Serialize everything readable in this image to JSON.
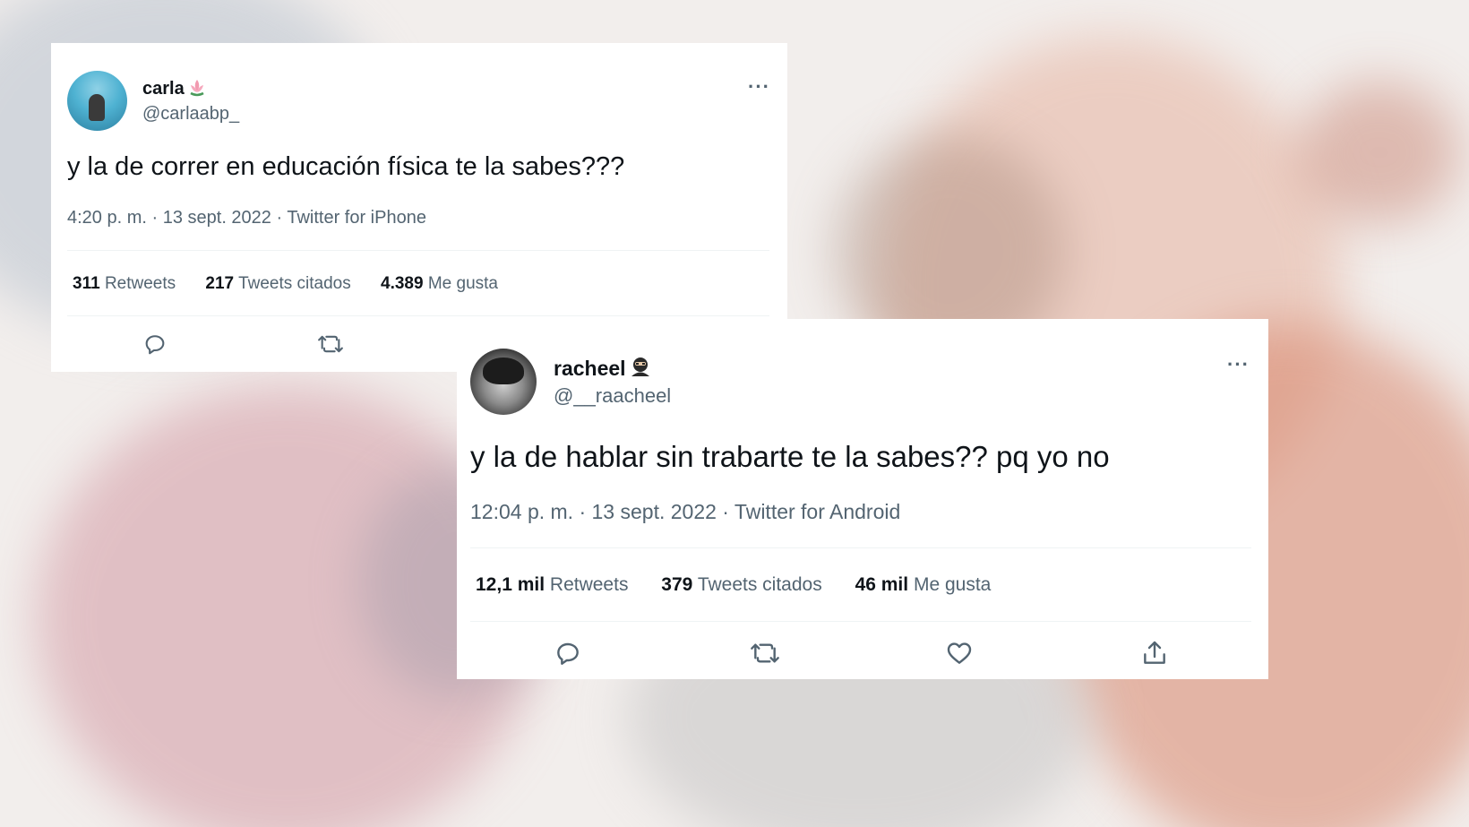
{
  "tweets": [
    {
      "display_name": "carla",
      "name_emoji": "lotus-emoji",
      "handle": "@carlaabp_",
      "more": "···",
      "text": "y la de correr en educación física te la sabes???",
      "meta": "4:20 p. m. · 13 sept. 2022 · Twitter for iPhone",
      "stats": {
        "retweets_count": "311",
        "retweets_label": "Retweets",
        "quotes_count": "217",
        "quotes_label": "Tweets citados",
        "likes_count": "4.389",
        "likes_label": "Me gusta"
      },
      "actions": [
        "reply-icon",
        "retweet-icon"
      ]
    },
    {
      "display_name": "racheel",
      "name_emoji": "ninja-emoji",
      "handle": "@__raacheel",
      "more": "···",
      "text": "y la de hablar sin trabarte te la sabes?? pq yo no",
      "meta": "12:04 p. m. · 13 sept. 2022 · Twitter for Android",
      "stats": {
        "retweets_count": "12,1 mil",
        "retweets_label": "Retweets",
        "quotes_count": "379",
        "quotes_label": "Tweets citados",
        "likes_count": "46 mil",
        "likes_label": "Me gusta"
      },
      "actions": [
        "reply-icon",
        "retweet-icon",
        "like-icon",
        "share-icon"
      ]
    }
  ],
  "colors": {
    "text": "#0f1419",
    "secondary": "#536471",
    "divider": "#eff3f4"
  }
}
